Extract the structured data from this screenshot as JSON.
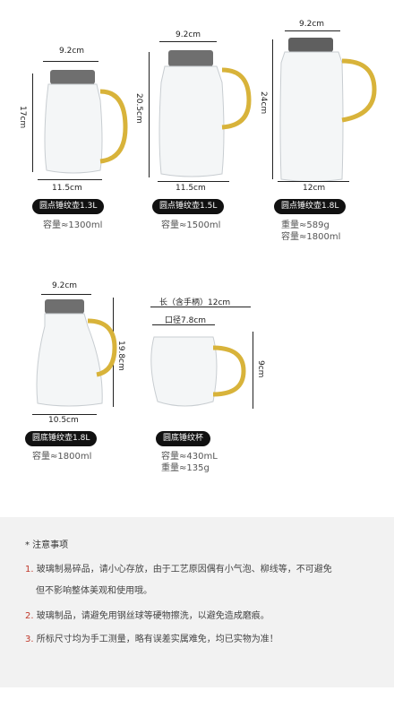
{
  "products": [
    {
      "name": "圆点锤纹壶1.3L",
      "width_label": "9.2cm",
      "height_label": "17cm",
      "base_label": "11.5cm",
      "capacity": "容量≈1300ml"
    },
    {
      "name": "圆点锤纹壶1.5L",
      "width_label": "9.2cm",
      "height_label": "20.5cm",
      "base_label": "11.5cm",
      "capacity": "容量≈1500ml"
    },
    {
      "name": "圆点锤纹壶1.8L",
      "width_label": "9.2cm",
      "height_label": "24cm",
      "base_label": "12cm",
      "weight": "重量≈589g",
      "capacity": "容量≈1800ml"
    },
    {
      "name": "圆底锤纹壶1.8L",
      "width_label": "9.2cm",
      "height_label": "19.8cm",
      "base_label": "10.5cm",
      "capacity": "容量≈1800ml"
    },
    {
      "name": "圆底锤纹杯",
      "length_label": "长（含手柄）12cm",
      "mouth_label": "口径7.8cm",
      "height_label": "9cm",
      "capacity": "容量≈430mL",
      "weight": "重量≈135g"
    }
  ],
  "notes": {
    "title": "* 注意事项",
    "items": [
      {
        "num": "1.",
        "line1": "玻璃制易碎品，请小心存放，由于工艺原因偶有小气泡、柳线等，不可避免",
        "line2": "但不影响整体美观和使用哦。"
      },
      {
        "num": "2.",
        "line1": "玻璃制品，请避免用钢丝球等硬物擦洗，以避免造成磨痕。"
      },
      {
        "num": "3.",
        "line1": "所标尺寸均为手工测量，略有误差实属难免，均已实物为准！"
      }
    ]
  }
}
